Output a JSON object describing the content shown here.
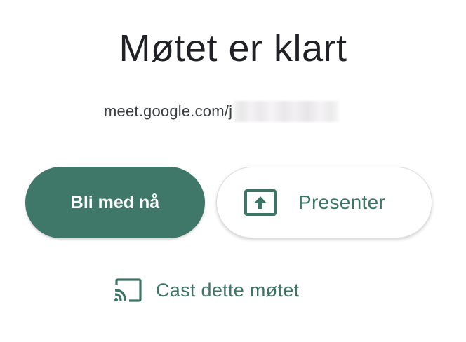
{
  "heading": {
    "title": "Møtet er klart"
  },
  "meeting_link": {
    "text": "meet.google.com/j"
  },
  "actions": {
    "join_label": "Bli med nå",
    "present_label": "Presenter",
    "present_icon": "present-screen-icon",
    "cast_label": "Cast dette møtet",
    "cast_icon": "cast-icon"
  },
  "colors": {
    "accent": "#3f7768",
    "title_text": "#202124",
    "link_text": "#3c4043",
    "action_text": "#3c7565"
  }
}
